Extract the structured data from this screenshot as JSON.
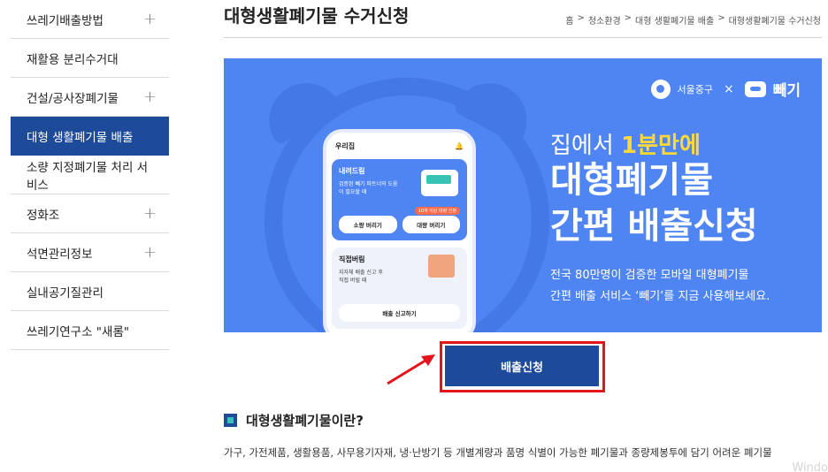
{
  "sidebar": {
    "items": [
      {
        "label": "쓰레기배출방법",
        "has_sub": true,
        "active": false
      },
      {
        "label": "재활용 분리수거대",
        "has_sub": false,
        "active": false
      },
      {
        "label": "건설/공사장폐기물",
        "has_sub": true,
        "active": false
      },
      {
        "label": "대형 생활폐기물 배출",
        "has_sub": false,
        "active": true
      },
      {
        "label": "소량 지정폐기물 처리 서비스",
        "has_sub": false,
        "active": false
      },
      {
        "label": "정화조",
        "has_sub": true,
        "active": false
      },
      {
        "label": "석면관리정보",
        "has_sub": true,
        "active": false
      },
      {
        "label": "실내공기질관리",
        "has_sub": false,
        "active": false
      },
      {
        "label": "쓰레기연구소 \"새롬\"",
        "has_sub": false,
        "active": false
      }
    ],
    "expand_symbol": "+"
  },
  "header": {
    "title": "대형생활폐기물 수거신청",
    "breadcrumb": [
      "홈",
      "청소환경",
      "대형 생활폐기물 배출",
      "대형생활폐기물 수거신청"
    ],
    "separator": ">"
  },
  "banner": {
    "logo_left": "서울중구",
    "logo_x": "×",
    "logo_right": "빼기",
    "headline_pre": "집에서 ",
    "headline_hl": "1분만에",
    "headline_line2": "대형폐기물",
    "headline_line3": "간편 배출신청",
    "sub_line1": "전국 80만명이 검증한 모바일 대형폐기물",
    "sub_line2": "간편 배출 서비스 ‘빼기’를 지금 사용해보세요.",
    "phone": {
      "header": "우리집",
      "card1_title": "내려드림",
      "card1_desc": "검증된 빼기 파트너의 도움이 필요할 때",
      "card1_tag": "10개 이상 대량 신청",
      "card1_btn1": "소량 버리기",
      "card1_btn2": "대량 버리기",
      "card2_title": "직접버림",
      "card2_desc1": "지자체 배출 신고 후",
      "card2_desc2": "직접 버릴 때",
      "card2_btn": "배출 신고하기"
    },
    "colors": {
      "bg": "#4f85f2",
      "highlight": "#ffd93a"
    }
  },
  "apply_button": {
    "label": "배출신청",
    "color": "#1e4a9a",
    "outline_color": "#e3141b"
  },
  "section": {
    "title": "대형생활폐기물이란?",
    "body": "가구, 가전제품, 생활용품, 사무용기자재, 냉·난방기 등 개별계량과 품명 식별이 가능한 폐기물과 종량제봉투에 담기 어려운 폐기물"
  },
  "watermark": "Windo"
}
